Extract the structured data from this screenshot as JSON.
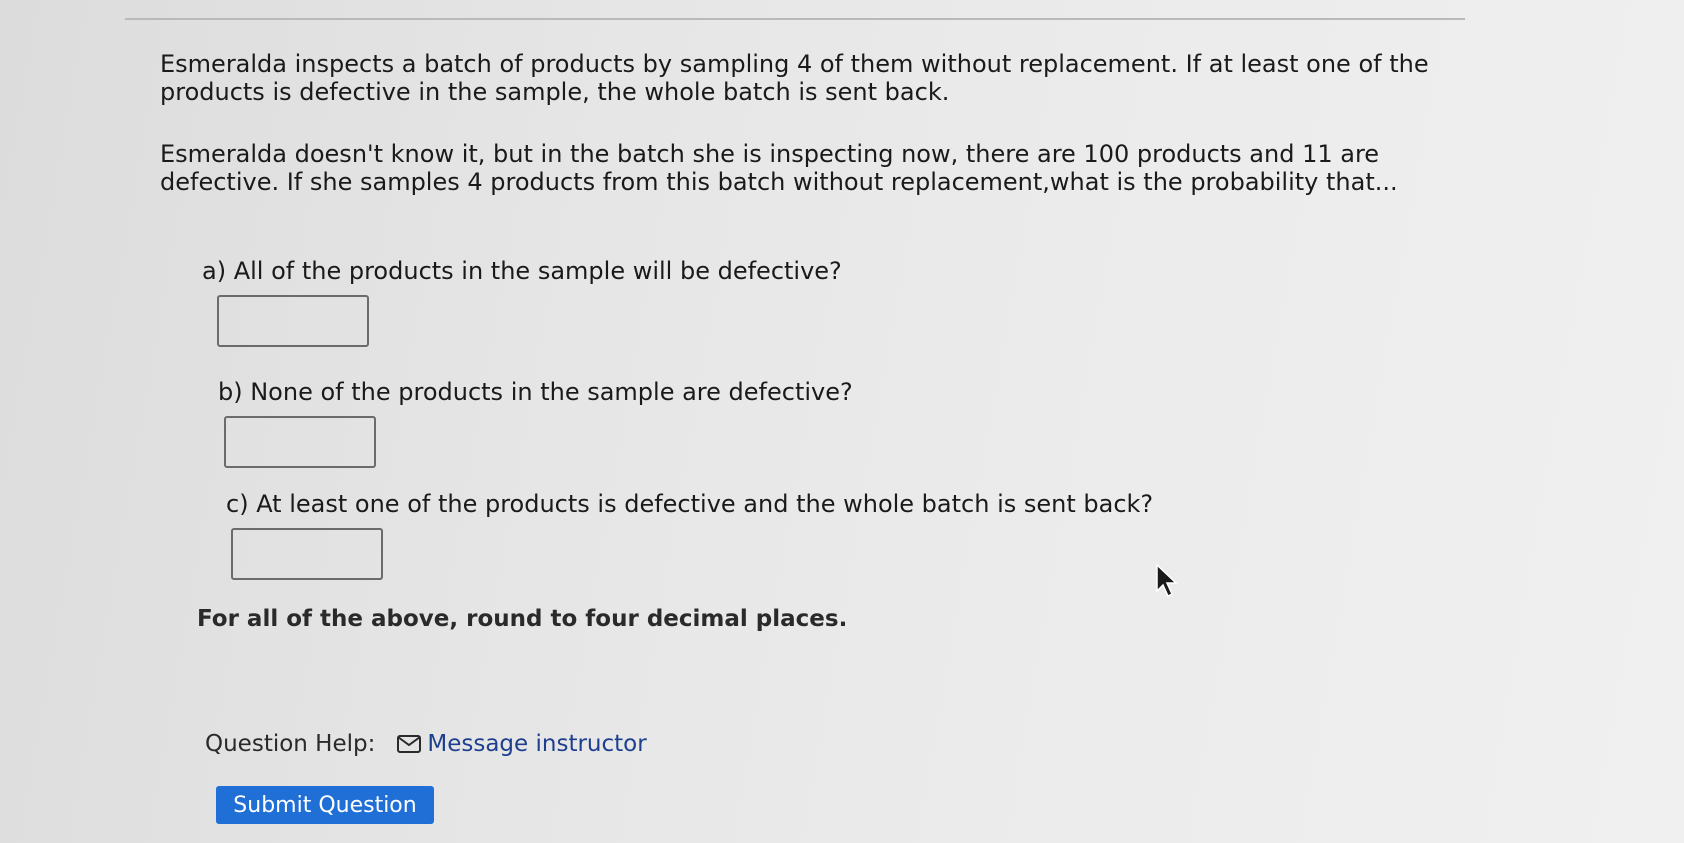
{
  "problem": {
    "paragraph1": "Esmeralda inspects a batch of products by sampling 4 of them without replacement. If at least one of the products is defective in the sample, the whole batch is sent back.",
    "paragraph2": "Esmeralda doesn't know it, but in the batch she is inspecting now, there are 100 products and 11 are defective. If she samples 4 products from this batch without replacement,what is the probability that..."
  },
  "parts": [
    {
      "label": "a) All of the products in the sample will be defective?",
      "value": ""
    },
    {
      "label": "b) None of the products in the sample are defective?",
      "value": ""
    },
    {
      "label": "c) At least one of the products is defective and the whole batch is sent back?",
      "value": ""
    }
  ],
  "round_note": "For all of the above, round to four decimal places.",
  "help": {
    "label": "Question Help:",
    "message_link": "Message instructor",
    "icon": "mail-icon"
  },
  "submit_label": "Submit Question",
  "colors": {
    "submit_bg": "#1f6fd6",
    "link": "#1e3f8f"
  }
}
